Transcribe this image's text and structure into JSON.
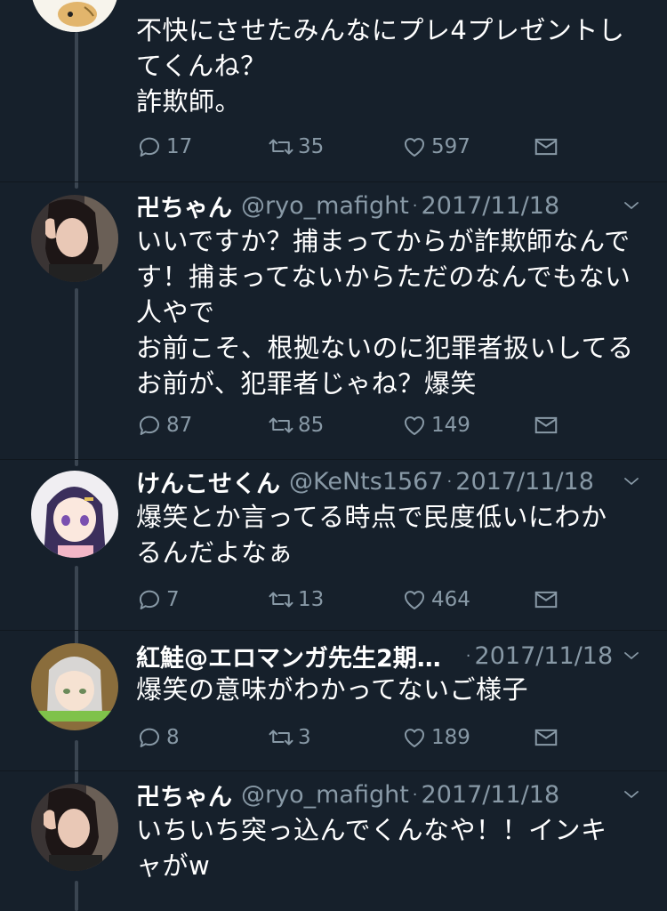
{
  "tweets": [
    {
      "name": "",
      "handle": "",
      "date": "",
      "text_lines": [
        "不快にさせたみんなにプレ4プレゼントし",
        "てくんね？",
        "詐欺師。"
      ],
      "reply_count": "17",
      "retweet_count": "35",
      "like_count": "597"
    },
    {
      "name": "卍ちゃん",
      "handle": "@ryo_mafight",
      "date": "2017/11/18",
      "text_lines": [
        "いいですか？捕まってからが詐欺師なんで",
        "す！捕まってないからただのなんでもない",
        "人やで",
        "お前こそ、根拠ないのに犯罪者扱いしてる",
        "お前が、犯罪者じゃね？爆笑"
      ],
      "reply_count": "87",
      "retweet_count": "85",
      "like_count": "149"
    },
    {
      "name": "けんこせくん",
      "handle": "@KeNts1567",
      "date": "2017/11/18",
      "text_lines": [
        "爆笑とか言ってる時点で民度低いにわか",
        "るんだよなぁ"
      ],
      "reply_count": "7",
      "retweet_count": "13",
      "like_count": "464"
    },
    {
      "name": "紅鮭@エロマンガ先生2期…",
      "handle": "",
      "date": "2017/11/18",
      "text_lines": [
        "爆笑の意味がわかってないご様子"
      ],
      "reply_count": "8",
      "retweet_count": "3",
      "like_count": "189"
    },
    {
      "name": "卍ちゃん",
      "handle": "@ryo_mafight",
      "date": "2017/11/18",
      "text_lines": [
        "いちいち突っ込んでくんなや！！インキ",
        "ャがw"
      ]
    }
  ],
  "colors": {
    "background": "#16202b",
    "secondary_text": "#8899a6",
    "thread_line": "#3a4551"
  },
  "icons": [
    "reply-icon",
    "retweet-icon",
    "like-icon",
    "dm-icon",
    "chevron-down-icon"
  ]
}
